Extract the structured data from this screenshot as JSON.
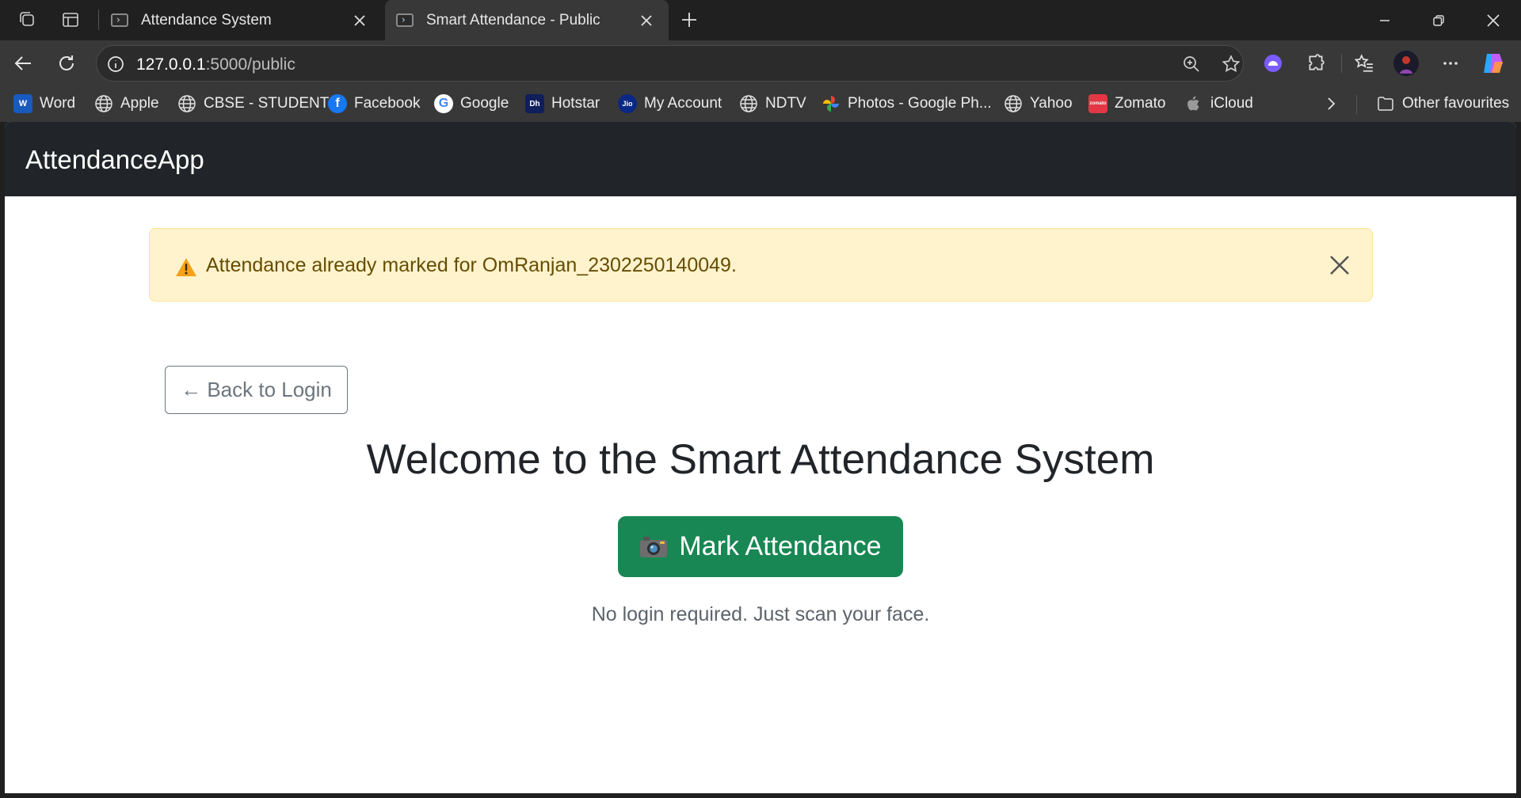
{
  "browser": {
    "tabs": [
      {
        "title": "Attendance System",
        "active": false
      },
      {
        "title": "Smart Attendance - Public",
        "active": true
      }
    ],
    "url_host": "127.0.0.1",
    "url_path": ":5000/public",
    "bookmarks": [
      {
        "label": "Word",
        "icon": "word-icon",
        "color": "#185abd"
      },
      {
        "label": "Apple",
        "icon": "globe-icon"
      },
      {
        "label": "CBSE - STUDENT",
        "icon": "globe-icon"
      },
      {
        "label": "Facebook",
        "icon": "facebook-icon",
        "color": "#1877f2"
      },
      {
        "label": "Google",
        "icon": "google-icon"
      },
      {
        "label": "Hotstar",
        "icon": "hotstar-icon",
        "color": "#0f1f5c"
      },
      {
        "label": "My Account",
        "icon": "jio-icon",
        "color": "#0a2885"
      },
      {
        "label": "NDTV",
        "icon": "globe-icon"
      },
      {
        "label": "Photos - Google Ph...",
        "icon": "google-photos-icon"
      },
      {
        "label": "Yahoo",
        "icon": "globe-icon"
      },
      {
        "label": "Zomato",
        "icon": "zomato-icon",
        "color": "#e23744"
      },
      {
        "label": "iCloud",
        "icon": "apple-icon"
      }
    ],
    "other_favourites": "Other favourites"
  },
  "app": {
    "brand": "AttendanceApp",
    "alert": {
      "text": "Attendance already marked for OmRanjan_2302250140049.",
      "icon": "warning-icon"
    },
    "back_button": "← Back to Login",
    "welcome": "Welcome to the Smart Attendance System",
    "mark_button": "Mark Attendance",
    "mark_icon": "camera-icon",
    "note": "No login required. Just scan your face."
  },
  "colors": {
    "navbar": "#212529",
    "alert_bg": "#fff3cd",
    "alert_text": "#664d03",
    "success": "#198754",
    "secondary": "#6c757d"
  }
}
